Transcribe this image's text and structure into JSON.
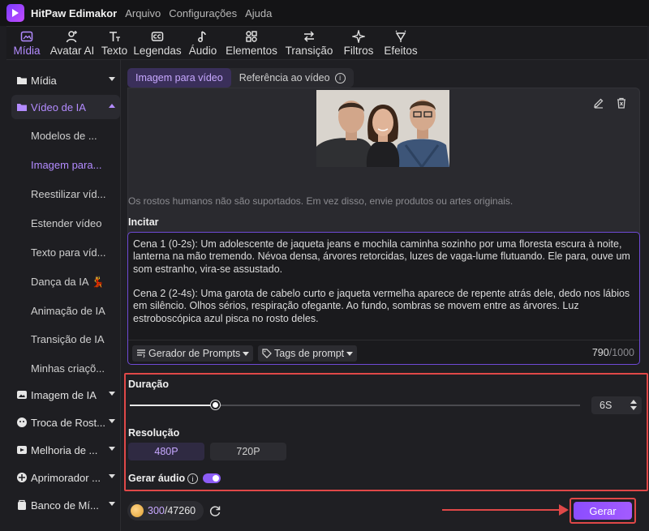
{
  "app": {
    "title": "HitPaw Edimakor"
  },
  "menu": [
    "Arquivo",
    "Configurações",
    "Ajuda"
  ],
  "toolbar": [
    {
      "label": "Mídia",
      "icon": "media-icon",
      "active": true
    },
    {
      "label": "Avatar AI",
      "icon": "avatar-add-icon"
    },
    {
      "label": "Texto",
      "icon": "text-icon"
    },
    {
      "label": "Legendas",
      "icon": "captions-icon"
    },
    {
      "label": "Áudio",
      "icon": "music-note-icon"
    },
    {
      "label": "Elementos",
      "icon": "elements-icon"
    },
    {
      "label": "Transição",
      "icon": "transition-icon"
    },
    {
      "label": "Filtros",
      "icon": "sparkle-icon"
    },
    {
      "label": "Efeitos",
      "icon": "effects-icon"
    }
  ],
  "sidebar": {
    "groups": [
      {
        "label": "Mídia",
        "icon": "folder-icon"
      },
      {
        "label": "Vídeo de IA",
        "icon": "folder-icon",
        "open": true
      },
      {
        "label": "Imagem de IA",
        "icon": "image-icon"
      },
      {
        "label": "Troca de Rost...",
        "icon": "face-swap-icon"
      },
      {
        "label": "Melhoria de ...",
        "icon": "enhance-icon"
      },
      {
        "label": "Aprimorador ...",
        "icon": "enhancer-icon"
      },
      {
        "label": "Banco de Mí...",
        "icon": "media-bank-icon"
      }
    ],
    "sub_items": [
      {
        "label": "Modelos de ..."
      },
      {
        "label": "Imagem para...",
        "active": true
      },
      {
        "label": "Reestilizar víd..."
      },
      {
        "label": "Estender vídeo"
      },
      {
        "label": "Texto para víd..."
      },
      {
        "label": "Dança da IA 💃"
      },
      {
        "label": "Animação de IA"
      },
      {
        "label": "Transição de IA"
      },
      {
        "label": "Minhas criaçõ..."
      }
    ]
  },
  "main": {
    "tabs": [
      {
        "label": "Imagem para vídeo",
        "active": true
      },
      {
        "label": "Referência ao vídeo"
      }
    ],
    "note": "Os rostos humanos não são suportados. Em vez disso, envie produtos ou artes originais.",
    "prompt": {
      "label": "Incitar",
      "text": "Cena 1 (0-2s): Um adolescente de jaqueta jeans e mochila caminha sozinho por uma floresta escura à noite, lanterna na mão tremendo. Névoa densa, árvores retorcidas, luzes de vaga-lume flutuando. Ele para, ouve um som estranho, vira-se assustado.\n\nCena 2 (2-4s): Uma garota de cabelo curto e jaqueta vermelha aparece de repente atrás dele, dedo nos lábios em silêncio. Olhos sérios, respiração ofegante. Ao fundo, sombras se movem entre as árvores. Luz estroboscópica azul pisca no rosto deles.",
      "generator_label": "Gerador de Prompts",
      "tags_label": "Tags de prompt",
      "count": "790",
      "max": "/1000"
    },
    "duration": {
      "label": "Duração",
      "value": "6S",
      "fraction": 0.19
    },
    "resolution": {
      "label": "Resolução",
      "options": [
        "480P",
        "720P"
      ],
      "selected": "480P"
    },
    "audio": {
      "label": "Gerar áudio",
      "enabled": true
    },
    "credits": {
      "used": "300",
      "total": "/47260"
    },
    "generate_label": "Gerar"
  },
  "colors": {
    "accent": "#8c5cf6",
    "highlight": "#e04848"
  }
}
